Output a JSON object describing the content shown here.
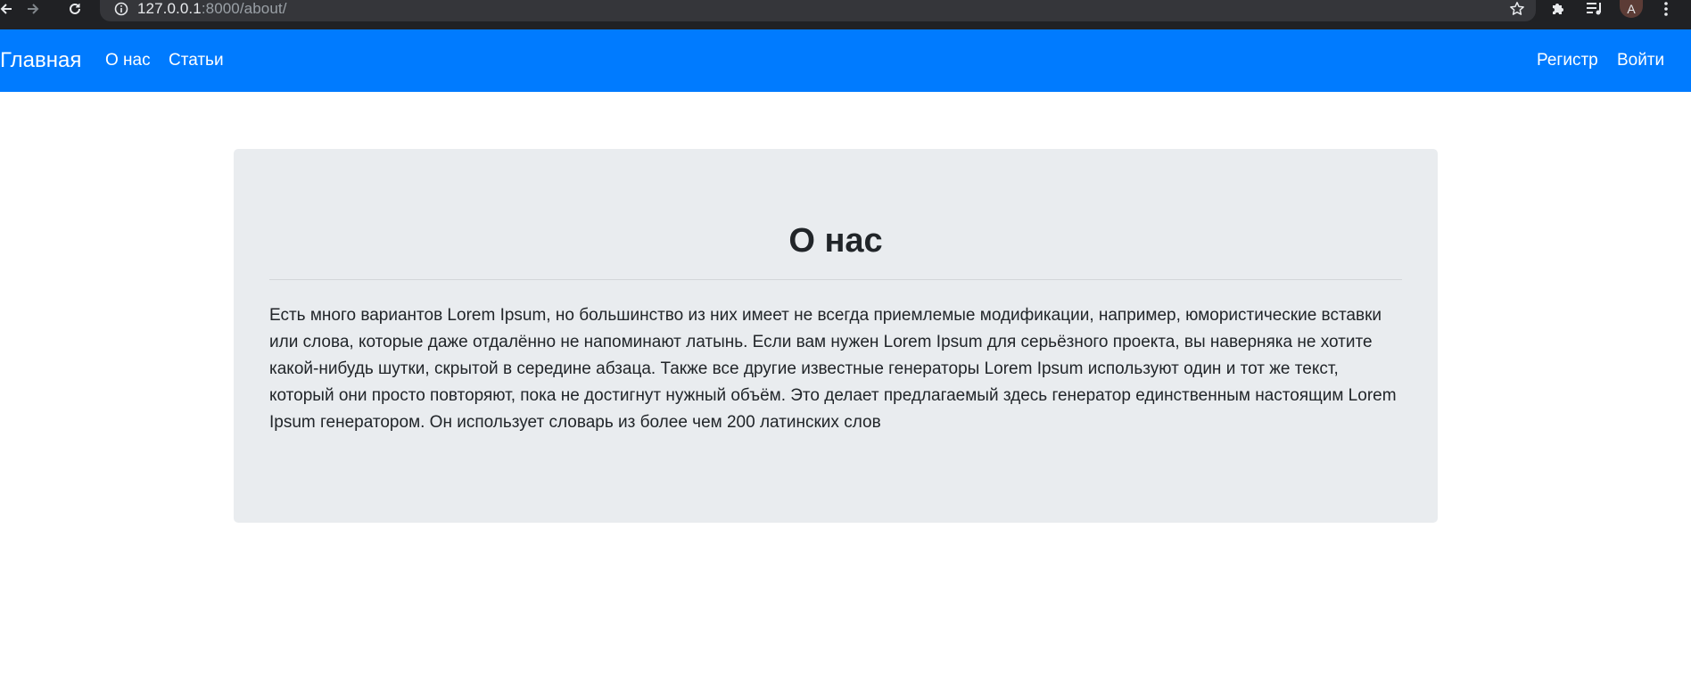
{
  "browser": {
    "url_host": "127.0.0.1",
    "url_path": ":8000/about/",
    "profile_initial": "A"
  },
  "navbar": {
    "brand": "Главная",
    "links": [
      "О нас",
      "Статьи"
    ],
    "right_links": [
      "Регистр",
      "Войти"
    ],
    "background": "#007bff"
  },
  "jumbotron": {
    "title": "О нас",
    "text": "Есть много вариантов Lorem Ipsum, но большинство из них имеет не всегда приемлемые модификации, например, юмористические вставки или слова, которые даже отдалённо не напоминают латынь. Если вам нужен Lorem Ipsum для серьёзного проекта, вы наверняка не хотите какой-нибудь шутки, скрытой в середине абзаца. Также все другие известные генераторы Lorem Ipsum используют один и тот же текст, который они просто повторяют, пока не достигнут нужный объём. Это делает предлагаемый здесь генератор единственным настоящим Lorem Ipsum генератором. Он использует словарь из более чем 200 латинских слов",
    "background": "#e9ecef"
  },
  "icons": {
    "back": "back-arrow-icon",
    "forward": "forward-arrow-icon",
    "reload": "reload-icon",
    "info": "info-icon",
    "bookmark": "star-icon",
    "extensions": "puzzle-icon",
    "media": "media-queue-icon",
    "menu": "kebab-menu-icon"
  }
}
